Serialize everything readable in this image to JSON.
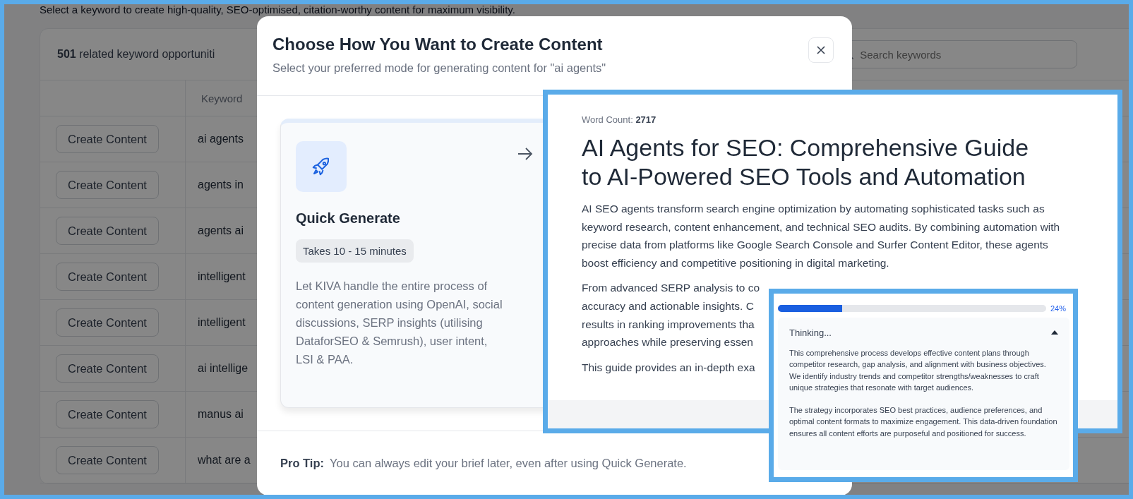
{
  "page": {
    "intro": "Select a keyword to create high-quality, SEO-optimised, citation-worthy content for maximum visibility.",
    "summary": "**501** related keyword opportuniti",
    "search": {
      "placeholder": "Search keywords"
    },
    "column_2": "Keyword",
    "rows": [
      {
        "action": "Create Content",
        "keyword": "ai agents"
      },
      {
        "action": "Create Content",
        "keyword": "agents in"
      },
      {
        "action": "Create Content",
        "keyword": "agents ai"
      },
      {
        "action": "Create Content",
        "keyword": "intelligent"
      },
      {
        "action": "Create Content",
        "keyword": "intelligent"
      },
      {
        "action": "Create Content",
        "keyword": "ai intellige"
      },
      {
        "action": "Create Content",
        "keyword": "manus ai"
      },
      {
        "action": "Create Content",
        "keyword": "what are a"
      }
    ]
  },
  "dialog": {
    "title": "Choose How You Want to Create Content",
    "subtitle": "Select your preferred mode for generating content for \"ai agents\"",
    "options": [
      {
        "title": "Quick Generate",
        "duration": "Takes 10 - 15 minutes",
        "description": "Let KIVA handle the entire process of content generation using OpenAI, social discussions, SERP insights (utilising DataforSEO & Semrush), user intent, LSI & PAA."
      }
    ],
    "tip_label": "Pro Tip:",
    "tip": "You can always edit your brief later, even after using Quick Generate."
  },
  "article_preview": {
    "word_count_label": "Word Count:",
    "word_count": "2717",
    "title": "AI Agents for SEO: Comprehensive Guide to AI-Powered SEO Tools and Automation",
    "intro": "AI SEO agents transform search engine optimization by automating sophisticated tasks such as keyword research, content enhancement, and technical SEO audits. By combining automation with precise data from platforms like Google Search Console and Surfer Content Editor, these agents boost efficiency and competitive positioning in digital marketing.",
    "partial_lines": [
      "From advanced SERP analysis to co",
      "accuracy and actionable insights. C",
      "results in ranking improvements tha",
      "approaches while preserving essen"
    ],
    "last_line": "This guide provides an in-depth exa"
  },
  "progress_preview": {
    "level": 0.24,
    "percent": "24%",
    "section": {
      "title": "Thinking...",
      "expanded": true,
      "paragraphs": [
        "This comprehensive process develops effective content plans through competitor research, gap analysis, and alignment with business objectives. We identify industry trends and competitor strengths/weaknesses to craft unique strategies that resonate with target audiences.",
        "The strategy incorporates SEO best practices, audience preferences, and optimal content formats to maximize engagement. This data-driven foundation ensures all content efforts are purposeful and positioned for success."
      ]
    }
  }
}
